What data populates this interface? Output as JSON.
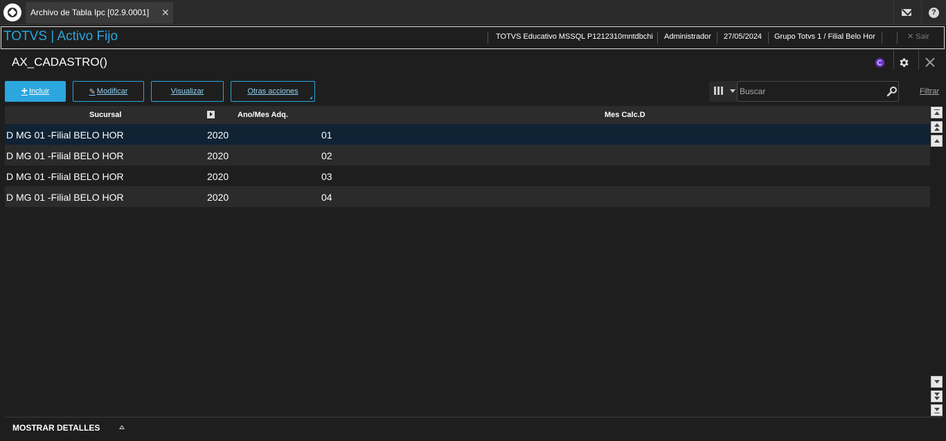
{
  "tabbar": {
    "tab_label": "Archivo de Tabla Ipc [02.9.0001]",
    "tab_close": "✕",
    "icons": [
      "mail-icon",
      "help-icon"
    ],
    "help_glyph": "?"
  },
  "header": {
    "app_title": "TOTVS | Activo Fijo",
    "environment": "TOTVS Educativo MSSQL P1212310mntdbchi",
    "user": "Administrador",
    "date": "27/05/2024",
    "branch": "Grupo Totvs 1 / Filial Belo Hor",
    "exit_label": "Sair",
    "exit_icon": "✕"
  },
  "page": {
    "title": "AX_CADASTRO()"
  },
  "toolbar": {
    "add_label": "Incluir",
    "edit_label": "Modificar",
    "view_label": "Visualizar",
    "more_label": "Otras acciones",
    "search_placeholder": "Buscar",
    "filter_label": "Filtrar"
  },
  "grid": {
    "columns": [
      "Sucursal",
      "Ano/Mes Adq.",
      "Mes Calc.D"
    ],
    "rows": [
      {
        "sucursal": "D MG 01 -Filial BELO HOR",
        "ano": "2020",
        "mes": "01"
      },
      {
        "sucursal": "D MG 01 -Filial BELO HOR",
        "ano": "2020",
        "mes": "02"
      },
      {
        "sucursal": "D MG 01 -Filial BELO HOR",
        "ano": "2020",
        "mes": "03"
      },
      {
        "sucursal": "D MG 01 -Filial BELO HOR",
        "ano": "2020",
        "mes": "04"
      }
    ]
  },
  "footer": {
    "details_label": "MOSTRAR DETALLES"
  },
  "colors": {
    "accent": "#2ba6de",
    "background": "#1e1e1e",
    "selected_row": "#0f2335",
    "alt_row": "#2b2b2b"
  }
}
